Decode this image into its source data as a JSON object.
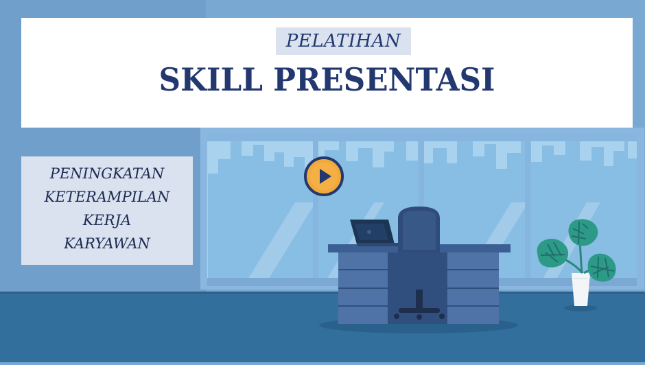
{
  "slide": {
    "kicker": "PELATIHAN",
    "title": "SKILL PRESENTASI",
    "subtitle_lines": [
      "PENINGKATAN",
      "KETERAMPILAN",
      "KERJA",
      "KARYAWAN"
    ]
  },
  "icons": {
    "play": "play-icon",
    "laptop": "laptop-icon",
    "chair": "office-chair-icon",
    "plant": "plant-icon"
  },
  "colors": {
    "wall": "#79a8d2",
    "window_frame": "#8bb7e0",
    "floor": "#336f9d",
    "title_text": "#22386f",
    "desk": "#3c5f93",
    "play_orange": "#f0a93b"
  }
}
